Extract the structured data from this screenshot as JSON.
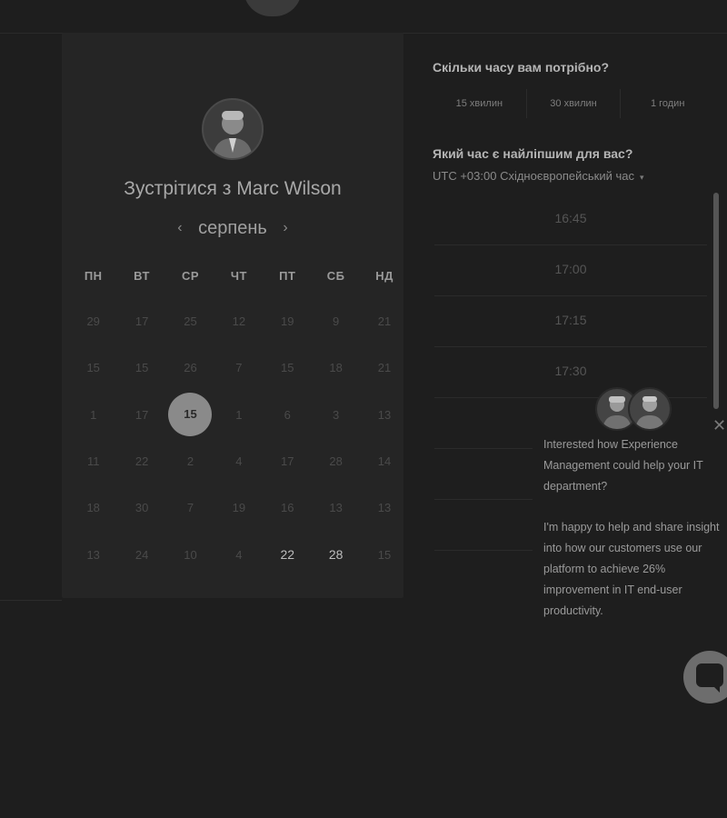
{
  "booking_card": {
    "title": "Зустрітися з Marc Wilson",
    "month": "серпень",
    "prev_arrow": "‹",
    "next_arrow": "›",
    "weekdays": [
      "ПН",
      "ВТ",
      "СР",
      "ЧТ",
      "ПТ",
      "СБ",
      "НД"
    ],
    "weeks": [
      [
        "29",
        "17",
        "25",
        "12",
        "19",
        "9",
        "21"
      ],
      [
        "15",
        "15",
        "26",
        "7",
        "15",
        "18",
        "21"
      ],
      [
        "1",
        "17",
        "15",
        "1",
        "6",
        "3",
        "13"
      ],
      [
        "11",
        "22",
        "2",
        "4",
        "17",
        "28",
        "14"
      ],
      [
        "18",
        "30",
        "7",
        "19",
        "16",
        "13",
        "13"
      ],
      [
        "13",
        "24",
        "10",
        "4",
        "22",
        "28",
        "15"
      ]
    ]
  },
  "duration": {
    "question": "Скільки часу вам потрібно?",
    "options": [
      "15 хвилин",
      "30 хвилин",
      "1 годин"
    ]
  },
  "time": {
    "question": "Який час є найліпшим для вас?",
    "timezone": "UTC +03:00 Східноєвропейський час",
    "caret": "▾",
    "slots": [
      "16:45",
      "17:00",
      "17:15",
      "17:30"
    ]
  },
  "chat_popup": {
    "close": "✕",
    "message_1": "Interested how Experience Management could help your IT department?",
    "message_2": "I'm happy to help and share insight into how our customers use our platform to achieve 26% improvement in IT end-user productivity."
  },
  "icons": {
    "chat_button": "chat-bubble-icon",
    "avatar": "person-avatar"
  }
}
